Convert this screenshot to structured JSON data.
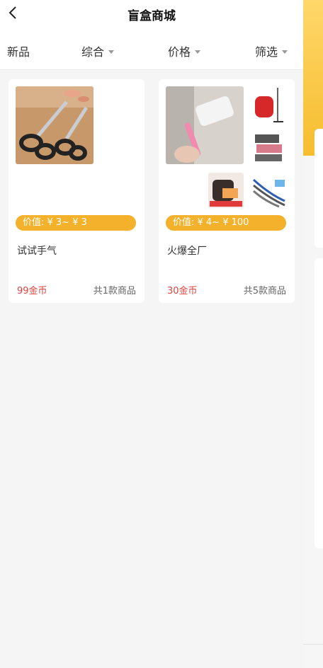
{
  "header": {
    "title": "盲盒商城"
  },
  "filters": [
    {
      "label": "新品",
      "has_caret": false
    },
    {
      "label": "综合",
      "has_caret": true
    },
    {
      "label": "价格",
      "has_caret": true
    },
    {
      "label": "筛选",
      "has_caret": true
    }
  ],
  "products": [
    {
      "price_label": "价值: ¥ 3~ ¥ 3",
      "name": "试试手气",
      "coins": "99金币",
      "count": "共1款商品",
      "images": [
        "scissors-image"
      ]
    },
    {
      "price_label": "价值: ¥ 4~ ¥ 100",
      "name": "火爆全厂",
      "coins": "30金币",
      "count": "共5款商品",
      "images": [
        "lint-roller-image",
        "garment-steamer-image",
        "storage-box-image",
        "air-fryer-image",
        "charging-cable-image"
      ]
    }
  ],
  "colors": {
    "accent": "#f3b12c",
    "coins": "#e0423f",
    "background": "#f5f5f5",
    "side_yellow": "#f6bd2e"
  }
}
